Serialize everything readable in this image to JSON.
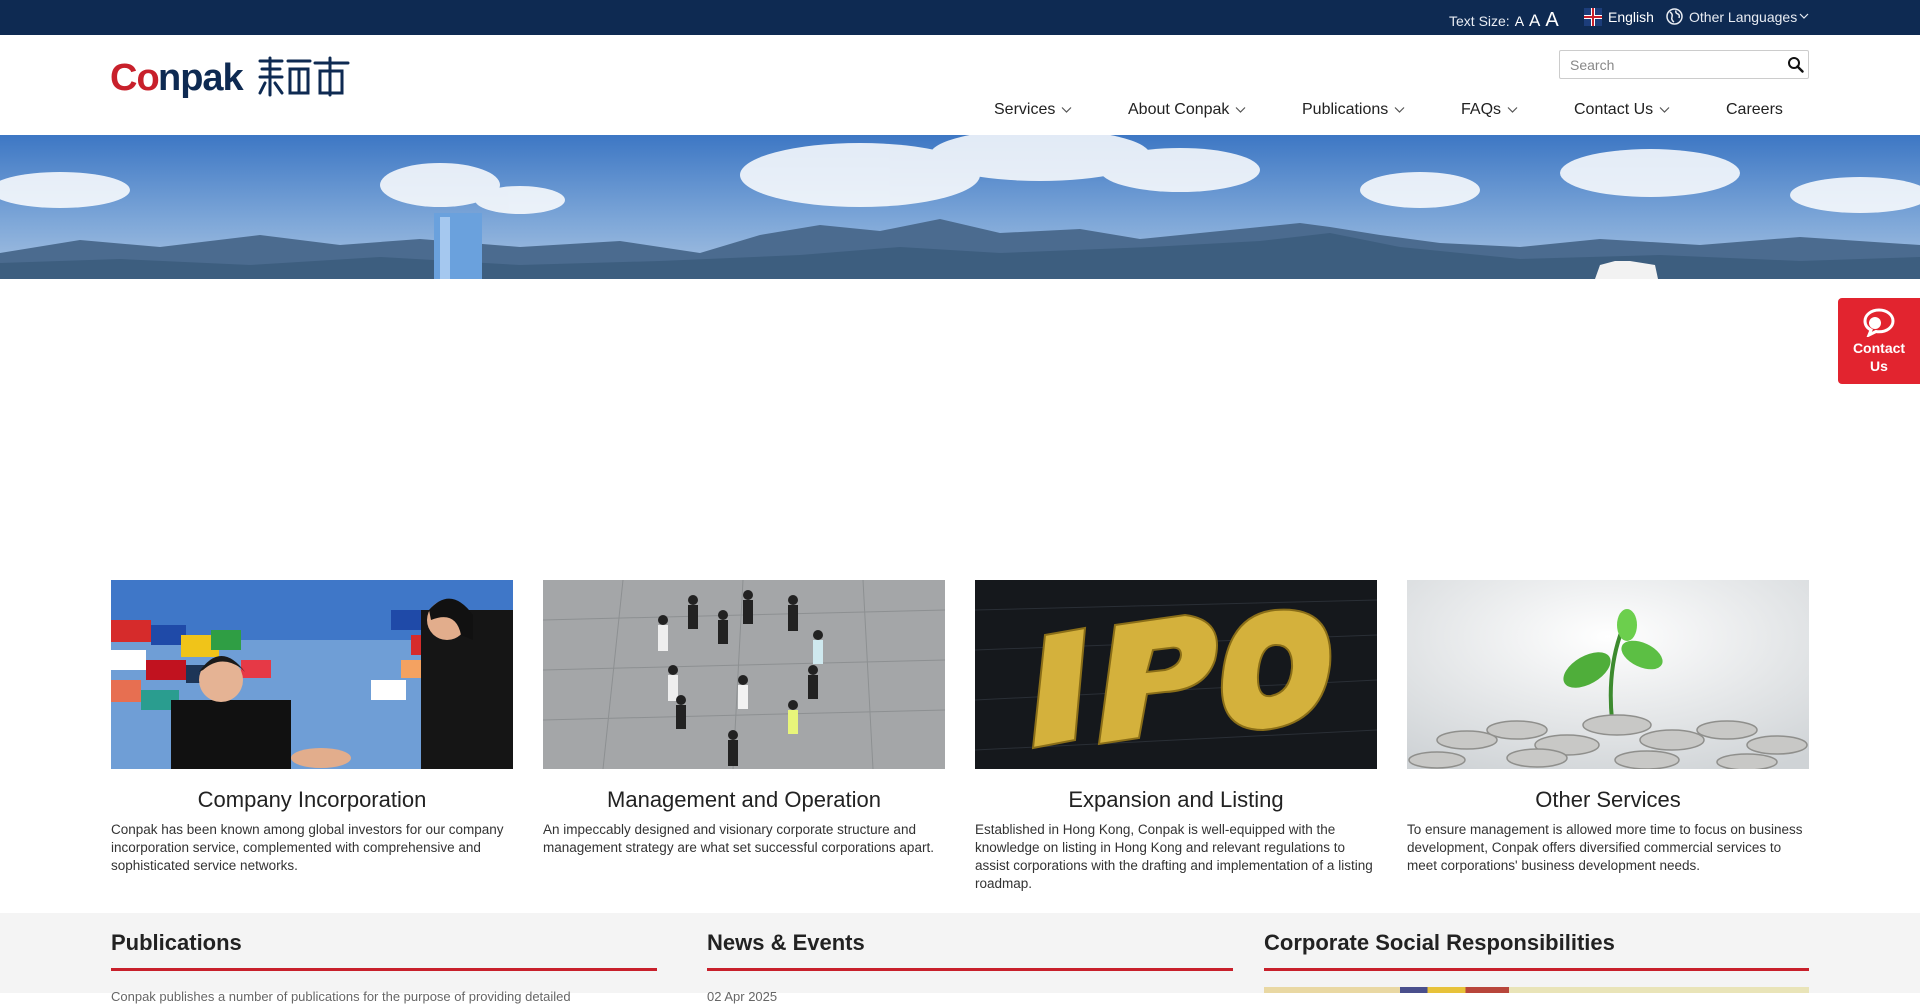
{
  "topbar": {
    "text_size_label": "Text Size:",
    "size_small": "A",
    "size_medium": "A",
    "size_large": "A",
    "language": "English",
    "other_languages": "Other Languages"
  },
  "header": {
    "search_placeholder": "Search",
    "nav": [
      {
        "label": "Services"
      },
      {
        "label": "About Conpak"
      },
      {
        "label": "Publications"
      },
      {
        "label": "FAQs"
      },
      {
        "label": "Contact Us"
      },
      {
        "label": "Careers"
      }
    ]
  },
  "contact_float": {
    "line1": "Contact",
    "line2": "Us"
  },
  "services": [
    {
      "title": "Company Incorporation",
      "description": "Conpak has been known among global investors for our company incorporation service, complemented with comprehensive and sophisticated service networks."
    },
    {
      "title": "Management and Operation",
      "description": "An impeccably designed and visionary corporate structure and management strategy are what set successful corporations apart."
    },
    {
      "title": "Expansion and Listing",
      "description": "Established in Hong Kong, Conpak is well-equipped with the knowledge on listing in Hong Kong and relevant regulations to assist corporations with the drafting and implementation of a listing roadmap."
    },
    {
      "title": "Other Services",
      "description": "To ensure management is allowed more time to focus on business development, Conpak offers diversified commercial services to meet corporations' business development needs."
    }
  ],
  "bottom": {
    "publications": {
      "title": "Publications",
      "text": "Conpak publishes a number of publications for the purpose of providing detailed"
    },
    "news": {
      "title": "News & Events",
      "text": "02 Apr 2025"
    },
    "csr": {
      "title": "Corporate Social Responsibilities"
    }
  },
  "colors": {
    "topbar": "#0e2a52",
    "accent": "#c8202b",
    "contact": "#e2242f"
  }
}
